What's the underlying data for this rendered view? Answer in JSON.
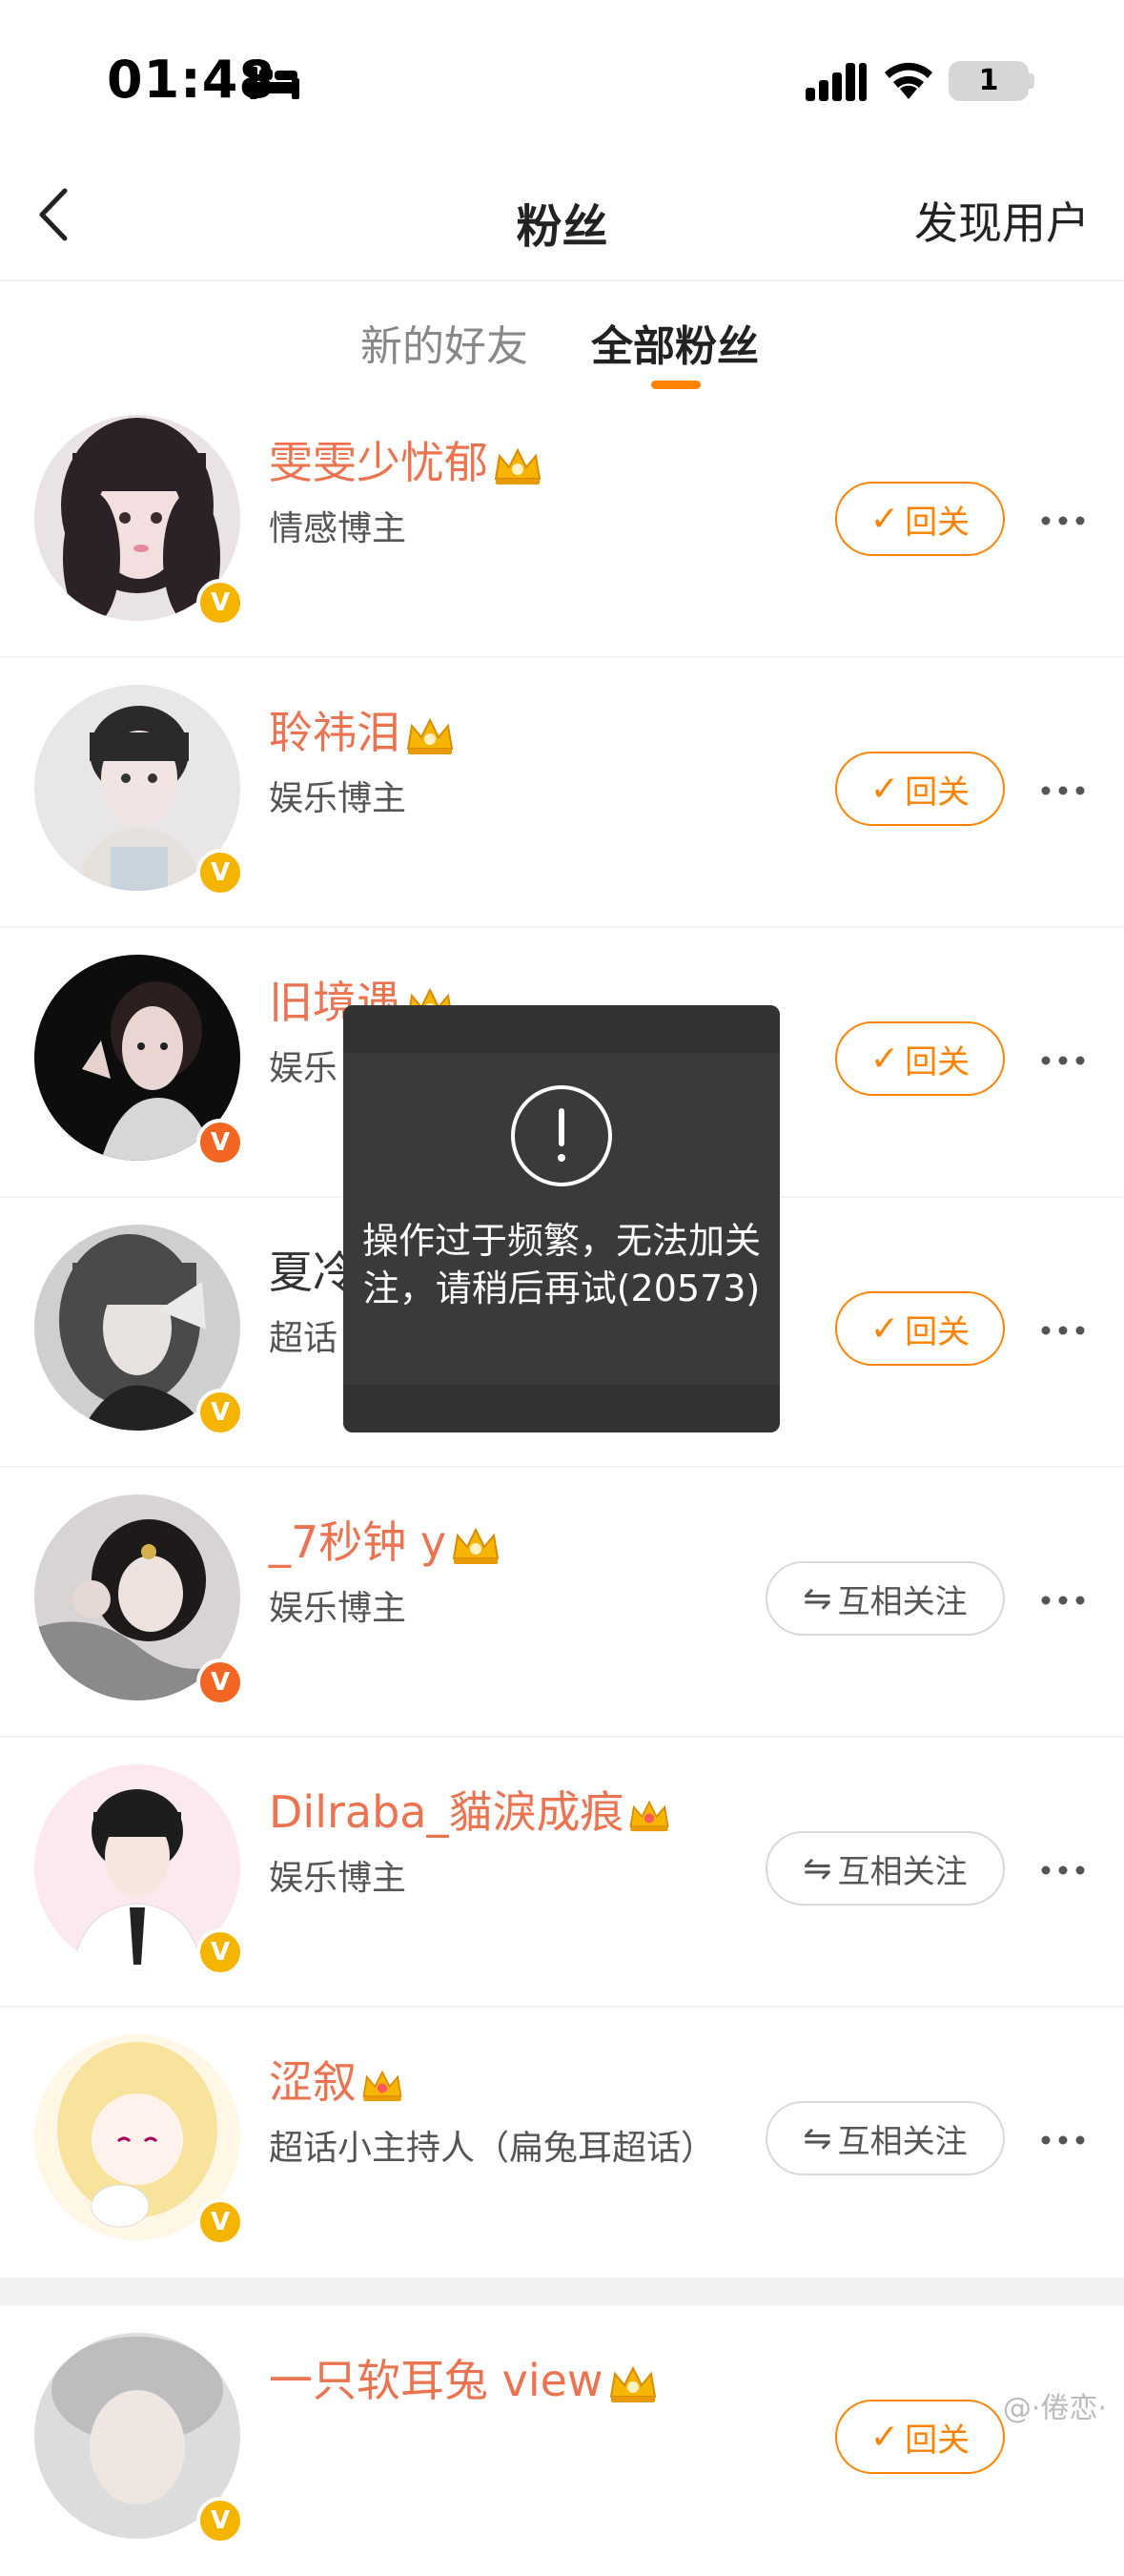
{
  "status": {
    "time": "01:48",
    "battery": "1"
  },
  "nav": {
    "title": "粉丝",
    "right_action": "发现用户"
  },
  "tabs": [
    "新的好友",
    "全部粉丝"
  ],
  "fans": [
    {
      "name": "雯雯少忧郁",
      "desc": "情感博主",
      "action": "回关",
      "badge": "yellow"
    },
    {
      "name": "聆祎泪",
      "desc": "娱乐博主",
      "action": "回关",
      "badge": "yellow"
    },
    {
      "name": "旧境遇",
      "desc": "娱乐",
      "action": "回关",
      "badge": "orange"
    },
    {
      "name": "夏冷",
      "desc": "超话",
      "action": "回关",
      "badge": "yellow"
    },
    {
      "name": "_7秒钟 y",
      "desc": "娱乐博主",
      "action": "互相关注",
      "badge": "orange"
    },
    {
      "name": "Dilraba_貓淚成痕",
      "desc": "娱乐博主",
      "action": "互相关注",
      "badge": "yellow"
    },
    {
      "name": "涩叙",
      "desc": "超话小主持人（扁兔耳超话）",
      "action": "互相关注",
      "badge": "yellow"
    },
    {
      "name": "一只软耳兔 view",
      "desc": "",
      "action": "回关",
      "badge": "yellow"
    }
  ],
  "toast": {
    "message": "操作过于频繁，无法加关注，请稍后再试(20573)"
  },
  "watermark": "@·倦恋·",
  "colors": {
    "accent": "#ff8200",
    "name": "#eb7350",
    "badge_yellow": "#f5b400",
    "badge_orange": "#f26522"
  }
}
